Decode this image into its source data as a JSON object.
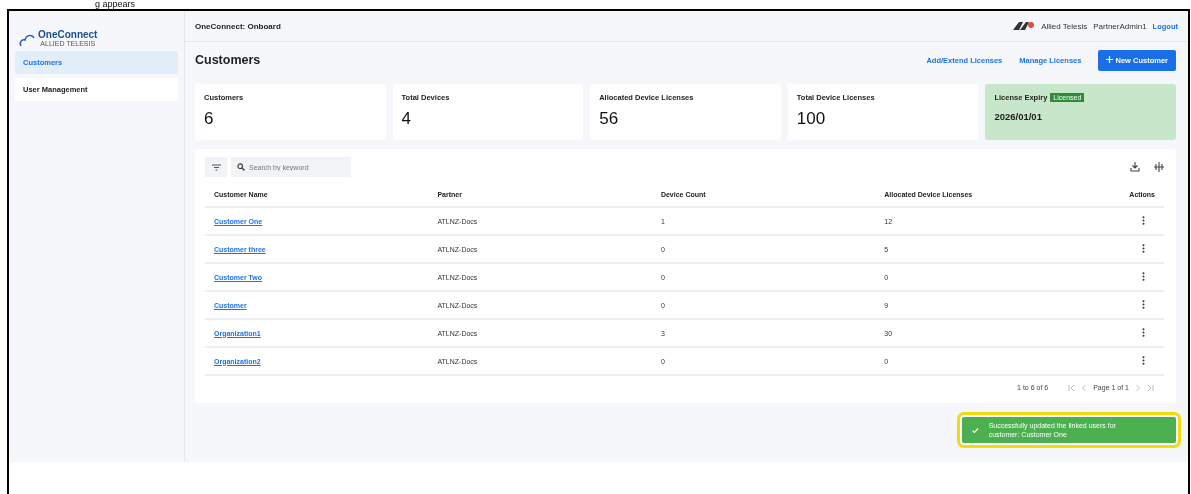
{
  "caption": "g appears",
  "sidebar": {
    "logo": {
      "name": "OneConnect",
      "tagline": "ALLIED TELESIS"
    },
    "items": [
      {
        "label": "Customers",
        "selected": true
      },
      {
        "label": "User Management",
        "selected": false
      }
    ]
  },
  "topbar": {
    "title": "OneConnect: Onboard",
    "brand": "Allied Telesis",
    "user": "PartnerAdmin1",
    "logout": "Logout"
  },
  "page": {
    "title": "Customers",
    "actions": [
      "Add/Extend Licenses",
      "Manage Licenses"
    ],
    "primary_button": "New Customer"
  },
  "stats": [
    {
      "kind": "number",
      "label": "Customers",
      "value": "6"
    },
    {
      "kind": "number",
      "label": "Total Devices",
      "value": "4"
    },
    {
      "kind": "number",
      "label": "Allocated Device Licenses",
      "value": "56"
    },
    {
      "kind": "number",
      "label": "Total Device Licenses",
      "value": "100"
    },
    {
      "kind": "expiry",
      "label": "License Expiry",
      "badge": "Licensed",
      "value": "2026/01/01"
    }
  ],
  "table": {
    "search": {
      "placeholder": "Search by keyword"
    },
    "columns": [
      "Customer Name",
      "Partner",
      "Device Count",
      "Allocated Device Licenses",
      "Actions"
    ],
    "rows": [
      {
        "name": "Customer One",
        "partner": "ATLNZ-Docs",
        "devices": "1",
        "licenses": "12"
      },
      {
        "name": "Customer three",
        "partner": "ATLNZ-Docs",
        "devices": "0",
        "licenses": "5"
      },
      {
        "name": "Customer Two",
        "partner": "ATLNZ-Docs",
        "devices": "0",
        "licenses": "0"
      },
      {
        "name": "Customer",
        "partner": "ATLNZ-Docs",
        "devices": "0",
        "licenses": "9"
      },
      {
        "name": "Organization1",
        "partner": "ATLNZ-Docs",
        "devices": "3",
        "licenses": "30"
      },
      {
        "name": "Organization2",
        "partner": "ATLNZ-Docs",
        "devices": "0",
        "licenses": "0"
      }
    ],
    "summary": "1 to 6 of 6",
    "page": "Page 1 of 1"
  },
  "toast": {
    "message": "Successfully updated the linked users for customer: Customer One",
    "highlighted": true
  }
}
